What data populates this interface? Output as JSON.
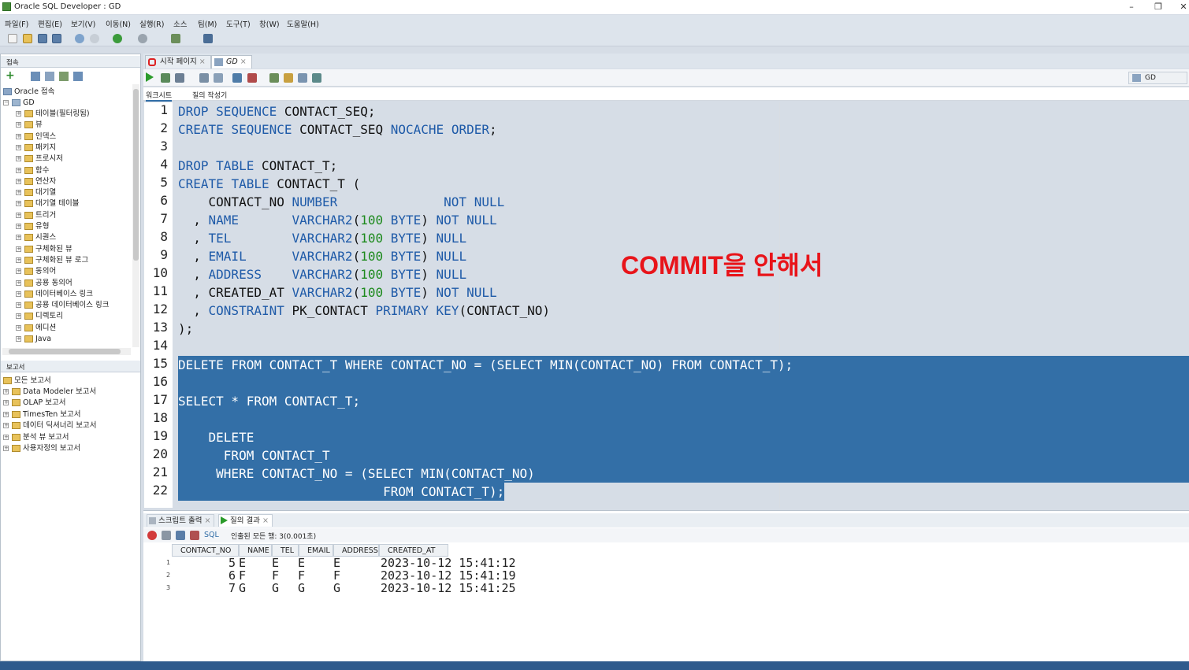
{
  "window": {
    "title": "Oracle SQL Developer : GD"
  },
  "menu": [
    "파일(F)",
    "편집(E)",
    "보기(V)",
    "이동(N)",
    "실행(R)",
    "소스",
    "팀(M)",
    "도구(T)",
    "창(W)",
    "도움말(H)"
  ],
  "connections_panel": {
    "title": "접속",
    "root": "Oracle 접속",
    "connection": "GD",
    "items": [
      "테이블(필터링됨)",
      "뷰",
      "인덱스",
      "패키지",
      "프로시저",
      "함수",
      "연산자",
      "대기열",
      "대기열 테이블",
      "트리거",
      "유형",
      "시퀀스",
      "구체화된 뷰",
      "구체화된 뷰 로그",
      "동의어",
      "공용 동의어",
      "데이터베이스 링크",
      "공용 데이터베이스 링크",
      "디렉토리",
      "에디션",
      "Java"
    ]
  },
  "reports_panel": {
    "title": "보고서",
    "root": "모든 보고서",
    "items": [
      "Data Modeler 보고서",
      "OLAP 보고서",
      "TimesTen 보고서",
      "데이터 딕셔너리 보고서",
      "분석 뷰 보고서",
      "사용자정의 보고서"
    ]
  },
  "editor": {
    "tabs": [
      "시작 페이지",
      "GD"
    ],
    "connection_selector": "GD",
    "subtabs": [
      "워크시트",
      "질의 작성기"
    ],
    "lines": [
      "DROP SEQUENCE CONTACT_SEQ;",
      "CREATE SEQUENCE CONTACT_SEQ NOCACHE ORDER;",
      "",
      "DROP TABLE CONTACT_T;",
      "CREATE TABLE CONTACT_T (",
      "    CONTACT_NO NUMBER              NOT NULL",
      "  , NAME       VARCHAR2(100 BYTE) NOT NULL",
      "  , TEL        VARCHAR2(100 BYTE) NULL",
      "  , EMAIL      VARCHAR2(100 BYTE) NULL",
      "  , ADDRESS    VARCHAR2(100 BYTE) NULL",
      "  , CREATED_AT VARCHAR2(100 BYTE) NOT NULL",
      "  , CONSTRAINT PK_CONTACT PRIMARY KEY(CONTACT_NO)",
      ");",
      "",
      "DELETE FROM CONTACT_T WHERE CONTACT_NO = (SELECT MIN(CONTACT_NO) FROM CONTACT_T);",
      "",
      "SELECT * FROM CONTACT_T;",
      "",
      "    DELETE",
      "      FROM CONTACT_T",
      "     WHERE CONTACT_NO = (SELECT MIN(CONTACT_NO)",
      "                           FROM CONTACT_T);"
    ],
    "annotation": "COMMIT을 안해서"
  },
  "results": {
    "tabs": [
      "스크립트 출력",
      "질의 결과"
    ],
    "sql_label": "SQL",
    "status": "인출된 모든 행: 3(0.001초)",
    "columns": [
      "CONTACT_NO",
      "NAME",
      "TEL",
      "EMAIL",
      "ADDRESS",
      "CREATED_AT"
    ],
    "rows": [
      [
        "1",
        "5",
        "E",
        "E",
        "E",
        "E",
        "2023-10-12 15:41:12"
      ],
      [
        "2",
        "6",
        "F",
        "F",
        "F",
        "F",
        "2023-10-12 15:41:19"
      ],
      [
        "3",
        "7",
        "G",
        "G",
        "G",
        "G",
        "2023-10-12 15:41:25"
      ]
    ]
  }
}
